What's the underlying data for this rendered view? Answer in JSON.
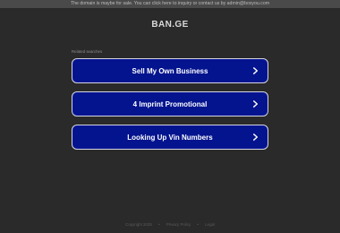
{
  "top_notice": "The domain is maybe for sale. You can click here to inquiry or contact us by admin@boxyou.com",
  "domain_title": "BAN.GE",
  "related_label": "Related searches",
  "buttons": [
    {
      "label": "Sell My Own Business",
      "icon": "chevron-right-icon"
    },
    {
      "label": "4 Imprint Promotional",
      "icon": "chevron-right-icon"
    },
    {
      "label": "Looking Up Vin Numbers",
      "icon": "chevron-right-icon"
    }
  ],
  "footer": {
    "copyright": "Copyright 2025",
    "separator": "•",
    "privacy": "Privacy Policy",
    "legal": "Legal"
  },
  "colors": {
    "background": "#2a2a2a",
    "button_bg": "#04148f",
    "button_border": "#d6d6e6"
  }
}
